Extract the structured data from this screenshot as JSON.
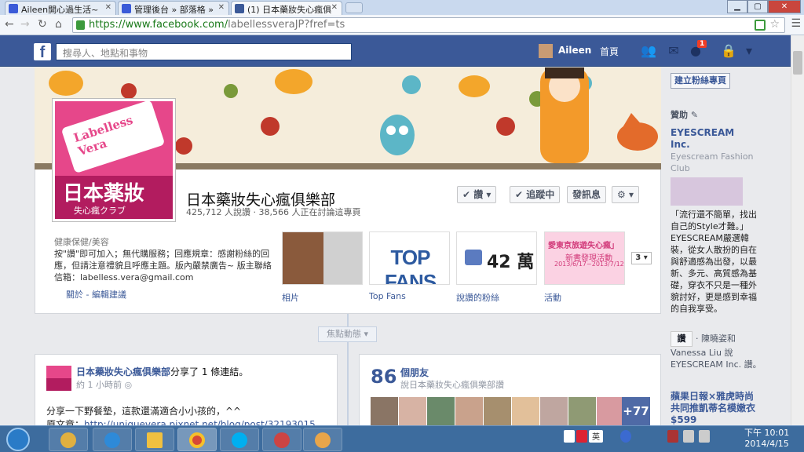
{
  "browser": {
    "tabs": [
      {
        "label": "Aileen開心過生活~",
        "active": false
      },
      {
        "label": "管理後台 » 部落格 »",
        "active": false
      },
      {
        "label": "(1) 日本藥妝失心瘋俱",
        "active": true
      }
    ],
    "window_buttons": {
      "minimize": "▁",
      "maximize": "▢",
      "close": "✕"
    },
    "url_host": "https://www.facebook.com/",
    "url_path": "labellessveraJP?fref=ts"
  },
  "fb_header": {
    "logo": "f",
    "search_placeholder": "搜尋人、地點和事物",
    "user_name": "Aileen",
    "home_label": "首頁",
    "notification_count": "1",
    "icons": [
      "friends-icon",
      "messages-icon",
      "notifications-icon",
      "privacy-icon",
      "settings-caret-icon"
    ]
  },
  "page": {
    "profile_logo_text": "Labelless Vera",
    "profile_title": "日本薬妝",
    "profile_subtitle": "失心瘋クラブ",
    "name": "日本藥妝失心瘋俱樂部",
    "stats": "425,712 人說讚 · 38,566 人正在討論這專頁",
    "buttons": {
      "like": "讚",
      "following": "追蹤中",
      "message": "發訊息",
      "gear": "⚙"
    },
    "about_category": "健康保健/美容",
    "about_text": "按\"讚\"即可加入；無代購服務；回應規章：感謝粉絲的回應，但請注意禮貌且呼應主題。版內嚴禁廣告~ 版主聯絡信箱：labelless.vera@gmail.com",
    "about_link": "關於 - 編輯建議",
    "tiles": [
      {
        "name": "photos",
        "label": "相片"
      },
      {
        "name": "top-fans",
        "label": "Top Fans",
        "text": "TOP FANS"
      },
      {
        "name": "likes",
        "label": "說讚的粉絲",
        "text": "42 萬"
      },
      {
        "name": "events",
        "label": "活動",
        "text1": "愛東京旅遊失心瘋」",
        "text2": "新書發現活動",
        "text3": "2013/6/17~2013/7/12"
      }
    ],
    "more_tiles": "3 ▾",
    "highlights": "焦點動態 ▾"
  },
  "post": {
    "author": "日本藥妝失心瘋俱樂部",
    "action": "分享了 1 條連結。",
    "time": "約 1 小時前",
    "text_line1": "分享一下野餐墊，這款還滿適合小小孩的，^^",
    "text_line2_prefix": "原文章：",
    "text_line2_link": "http://uniquevera.pixnet.net/blog/post/32193015"
  },
  "friends_box": {
    "count": "86",
    "label": "個朋友",
    "sub": "說日本藥妝失心瘋俱樂部讚",
    "more": "+77"
  },
  "right_col": {
    "create_button": "建立粉絲專頁",
    "sponsored": "贊助",
    "ad1_title": "EYESCREAM Inc.",
    "ad1_sub": "Eyescream Fashion Club",
    "ad1_body": "「流行還不簡單，找出自己的Style才難。」EYESCREAM嚴選韓裝，從女人散扮的自在與舒適感為出發，以最新、多元、高質感為基礎，穿衣不只是一種外貌討好，更是感到幸福的自我享受。",
    "like_btn": "讚",
    "like_info": "· 陳曉姿和",
    "like_info2": "Vanessa Liu 說 EYESCREAM Inc. 讚。",
    "ad2_title": "蘋果日報×雅虎時尚共同推凱蒂名模嫩衣$599"
  },
  "taskbar": {
    "time": "下午 10:01",
    "date": "2014/4/15",
    "ime": "英"
  },
  "colors": {
    "fb_blue": "#3b5998",
    "pink": "#e6478a",
    "accent_dark_pink": "#b21c5f"
  }
}
